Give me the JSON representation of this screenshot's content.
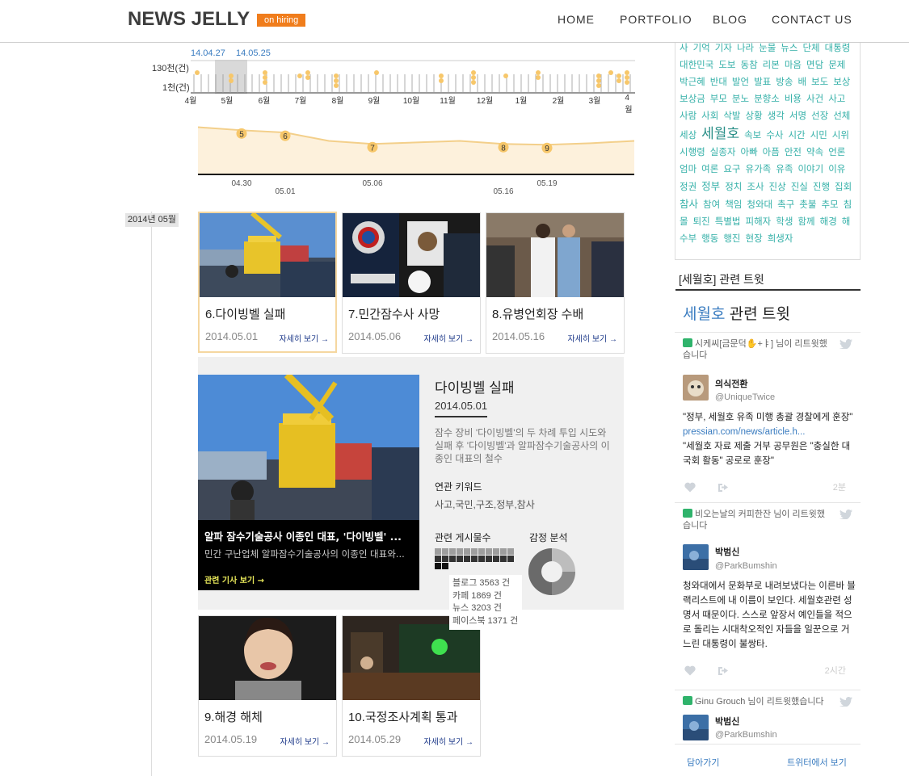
{
  "header": {
    "logo": "NEWS JELLY",
    "badge": "on hiring",
    "nav": [
      "HOME",
      "PORTFOLIO",
      "BLOG",
      "CONTACT US"
    ]
  },
  "colors": {
    "accent_orange": "#f07d1c",
    "dot_yellow": "#f7c76a",
    "tag_teal": "#34b0a8",
    "link_blue": "#3a7cc0"
  },
  "timeline_chart": {
    "selected_start": "14.04.27",
    "selected_end": "14.05.25",
    "y_labels": [
      "130천(건)",
      "1천(건)"
    ],
    "months": [
      "4월",
      "5월",
      "6월",
      "7월",
      "8월",
      "9월",
      "10월",
      "11월",
      "12월",
      "1월",
      "2월",
      "3월",
      "4월"
    ]
  },
  "chart_data": {
    "type": "area",
    "title": "",
    "xlabel": "",
    "ylabel": "",
    "x": [
      "04.27",
      "04.30",
      "05.01",
      "05.03",
      "05.06",
      "05.09",
      "05.12",
      "05.16",
      "05.19",
      "05.22",
      "05.25"
    ],
    "values": [
      62,
      58,
      55,
      44,
      40,
      42,
      44,
      40,
      39,
      41,
      44
    ],
    "markers": [
      {
        "label": "5",
        "x": "04.30"
      },
      {
        "label": "6",
        "x": "05.01"
      },
      {
        "label": "7",
        "x": "05.06"
      },
      {
        "label": "8",
        "x": "05.16"
      },
      {
        "label": "9",
        "x": "05.19"
      }
    ],
    "x_tick_labels": [
      "04.30",
      "05.01",
      "05.06",
      "05.16",
      "05.19"
    ]
  },
  "timeline": {
    "month_tag": "2014년 05월"
  },
  "cards": [
    {
      "title": "6.다이빙벨 실패",
      "date": "2014.05.01",
      "more": "자세히 보기 →"
    },
    {
      "title": "7.민간잠수사 사망",
      "date": "2014.05.06",
      "more": "자세히 보기 →"
    },
    {
      "title": "8.유병언회장 수배",
      "date": "2014.05.16",
      "more": "자세히 보기 →"
    },
    {
      "title": "9.해경 해체",
      "date": "2014.05.19",
      "more": "자세히 보기 →"
    },
    {
      "title": "10.국정조사계획 통과",
      "date": "2014.05.29",
      "more": "자세히 보기 →"
    }
  ],
  "detail": {
    "headline": "알파 잠수기술공사 이종인 대표, '다이빙벨' ...",
    "subline": "민간 구난업체 알파잠수기술공사의 이종인 대표와...",
    "article_link": "관련 기사 보기 →",
    "title": "다이빙벨 실패",
    "date": "2014.05.01",
    "description": "잠수 장비 '다이빙벨'의 두 차례 투입 시도와 실패 후 '다이빙벨'과 알파잠수기술공사의 이종인 대표의 철수",
    "keyword_label": "연관 키워드",
    "keywords": "사고,국민,구조,정부,참사",
    "posts_label": "관련 게시물수",
    "sentiment_label": "감정 분석",
    "post_counts": [
      "블로그 3563 건",
      "카페 1869 건",
      "뉴스 3203 건",
      "페이스북 1371 건"
    ]
  },
  "tag_cloud": [
    "사",
    "기억",
    "기자",
    "나라",
    "눈물",
    "뉴스",
    "단체",
    "대통령",
    "대한민국",
    "도보",
    "동참",
    "리본",
    "마음",
    "면담",
    "문제",
    "박근혜",
    "반대",
    "발언",
    "발표",
    "방송",
    "배",
    "보도",
    "보상",
    "보상금",
    "부모",
    "분노",
    "분향소",
    "비용",
    "사건",
    "사고",
    "사람",
    "사회",
    "삭발",
    "상황",
    "생각",
    "서명",
    "선장",
    "선체",
    "세상",
    "세월호",
    "속보",
    "수사",
    "시간",
    "시민",
    "시위",
    "시행령",
    "실종자",
    "아빠",
    "아픔",
    "안전",
    "약속",
    "언론",
    "엄마",
    "여론",
    "요구",
    "유가족",
    "유족",
    "이야기",
    "이유",
    "정권",
    "정부",
    "정치",
    "조사",
    "진상",
    "진실",
    "진행",
    "집회",
    "참사",
    "참여",
    "책임",
    "청와대",
    "촉구",
    "촛불",
    "추모",
    "침몰",
    "퇴진",
    "특별법",
    "피해자",
    "학생",
    "함께",
    "해경",
    "해수부",
    "행동",
    "행진",
    "현장",
    "희생자"
  ],
  "sidebar": {
    "section_title": "[세월호] 관련 트윗",
    "tw_keyword": "세월호",
    "tw_suffix": " 관련 트윗",
    "tweets": [
      {
        "retweeter": "시케씨[금문덕✋+ㅑ] 님이 리트윗했습니다",
        "name": "의식전환",
        "handle": "@UniqueTwice",
        "line1": "\"정부, 세월호 유족 미행 총괄 경찰에게 훈장\"",
        "link": "pressian.com/news/article.h...",
        "line2": "\"세월호 자료 제출 거부 공무원은 \"충실한 대국회 활동\" 공로로 훈장\"",
        "time": "2분"
      },
      {
        "retweeter": "비오는날의 커피한잔 님이 리트윗했습니다",
        "name": "박범신",
        "handle": "@ParkBumshin",
        "text": "청와대에서 문화부로 내려보냈다는 이른바 블랙리스트에 내 이름이 보인다. 세월호관련 성명서 때문이다. 스스로 앞장서 예인들을 적으로 돌리는 시대착오적인 자들을 일꾼으로 거느린 대통령이 불쌍타.",
        "time": "2시간"
      },
      {
        "retweeter": "Ginu Grouch 님이 리트윗했습니다",
        "name": "박범신",
        "handle": "@ParkBumshin"
      }
    ],
    "footer_left": "담아가기",
    "footer_right": "트위터에서 보기"
  }
}
